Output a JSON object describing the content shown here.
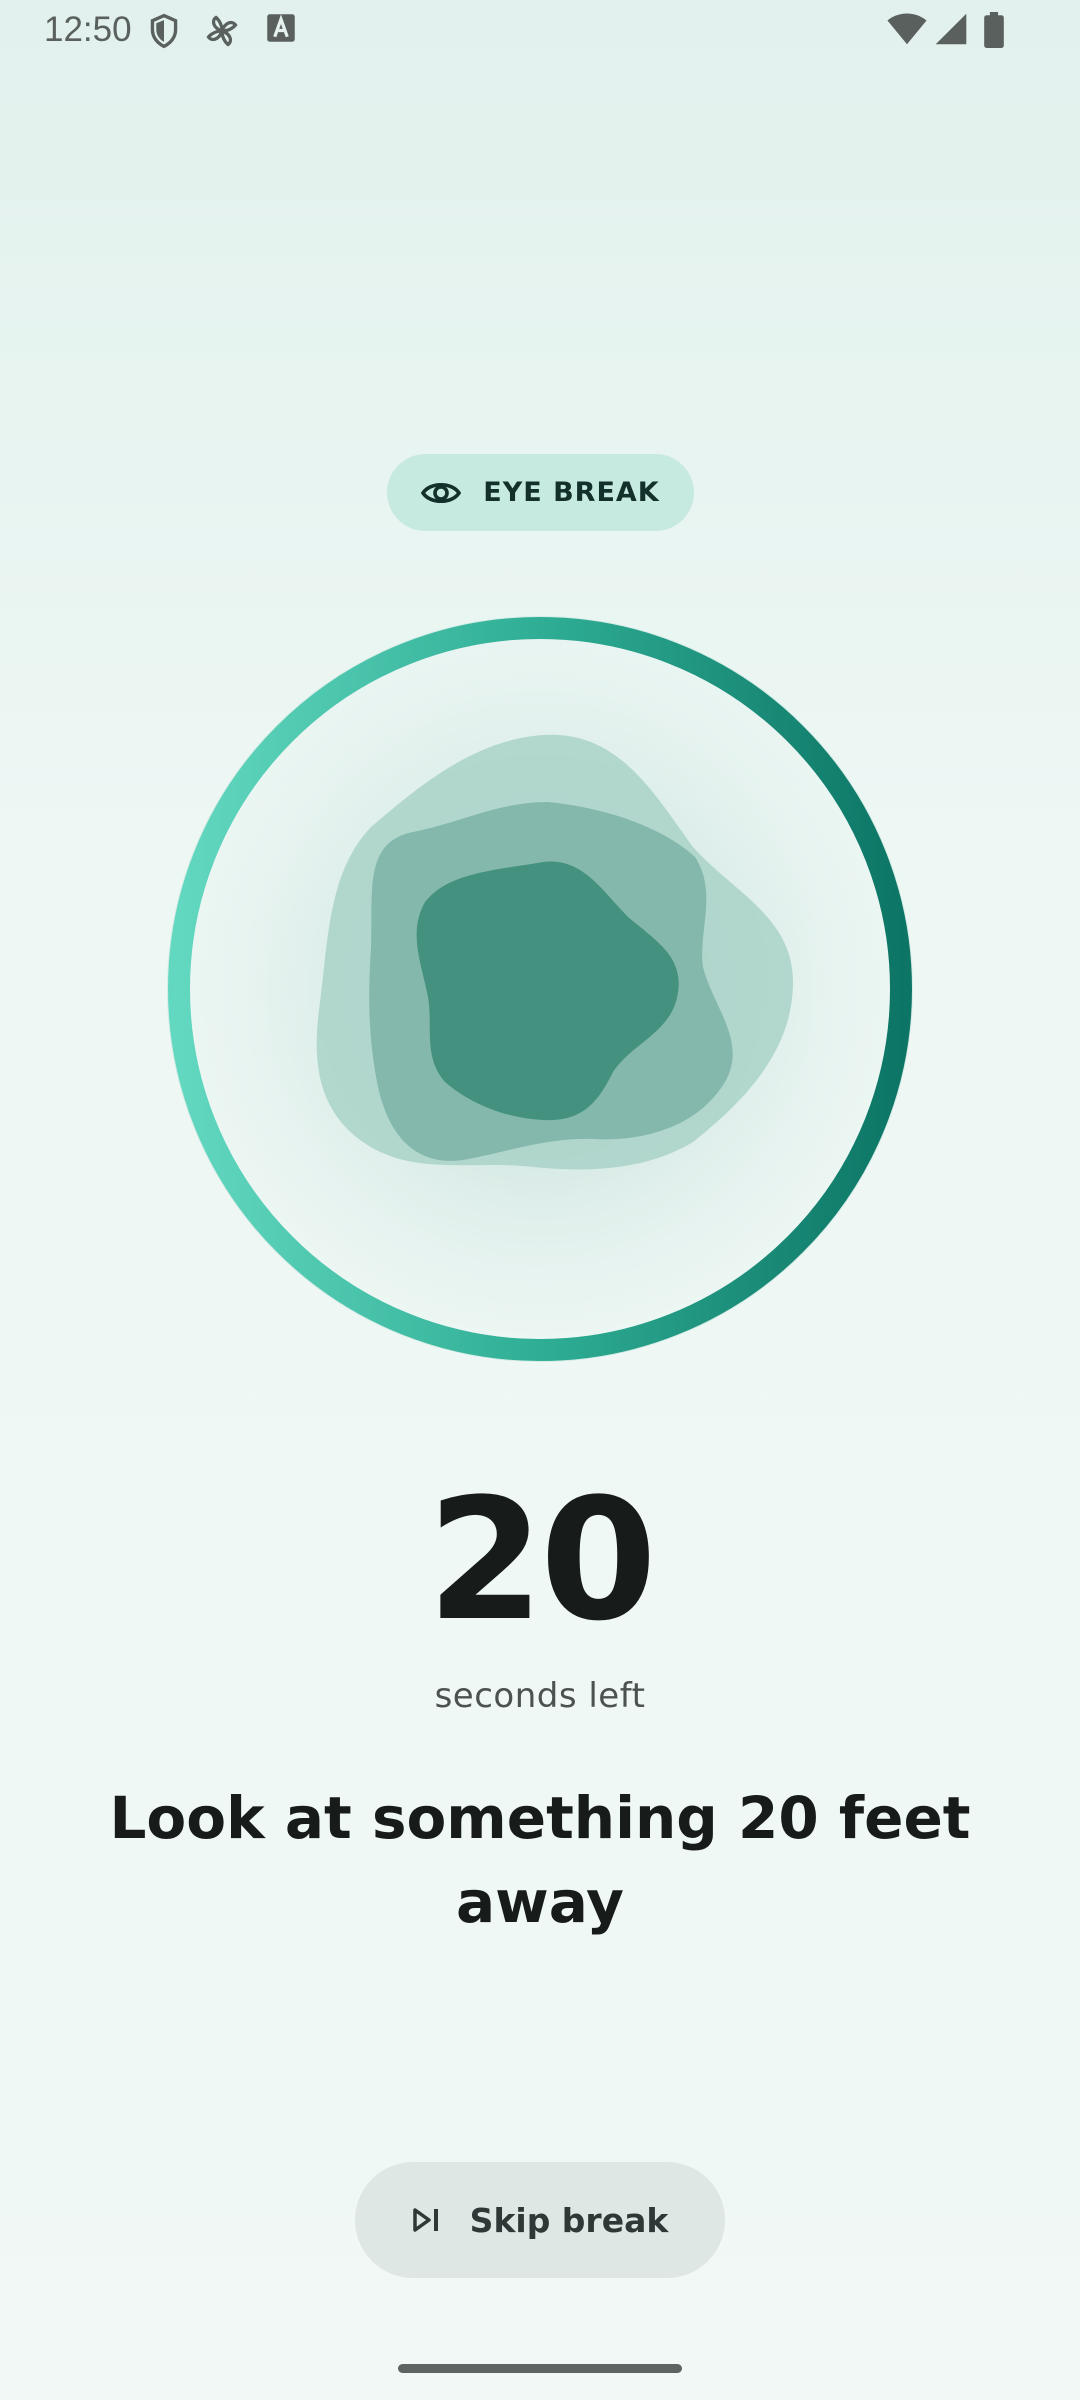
{
  "status_bar": {
    "time": "12:50",
    "left_icons": [
      "shield-icon",
      "pinwheel-icon",
      "text-a-icon"
    ],
    "right_icons": [
      "wifi-icon",
      "cellular-signal-icon",
      "battery-icon"
    ]
  },
  "chip": {
    "icon": "eye-icon",
    "label": "EYE BREAK"
  },
  "progress_ring": {
    "progress_fraction": 1.0,
    "gradient_start": "#63d8c0",
    "gradient_end": "#0d7565"
  },
  "timer": {
    "value": "20",
    "unit_label": "seconds left"
  },
  "instruction": "Look at something 20 feet away",
  "skip_button": {
    "icon": "skip-next-icon",
    "label": "Skip break"
  },
  "colors": {
    "accent": "#1f9a84",
    "chip_bg": "#c6e9e0",
    "button_bg": "#dfe7e4"
  }
}
